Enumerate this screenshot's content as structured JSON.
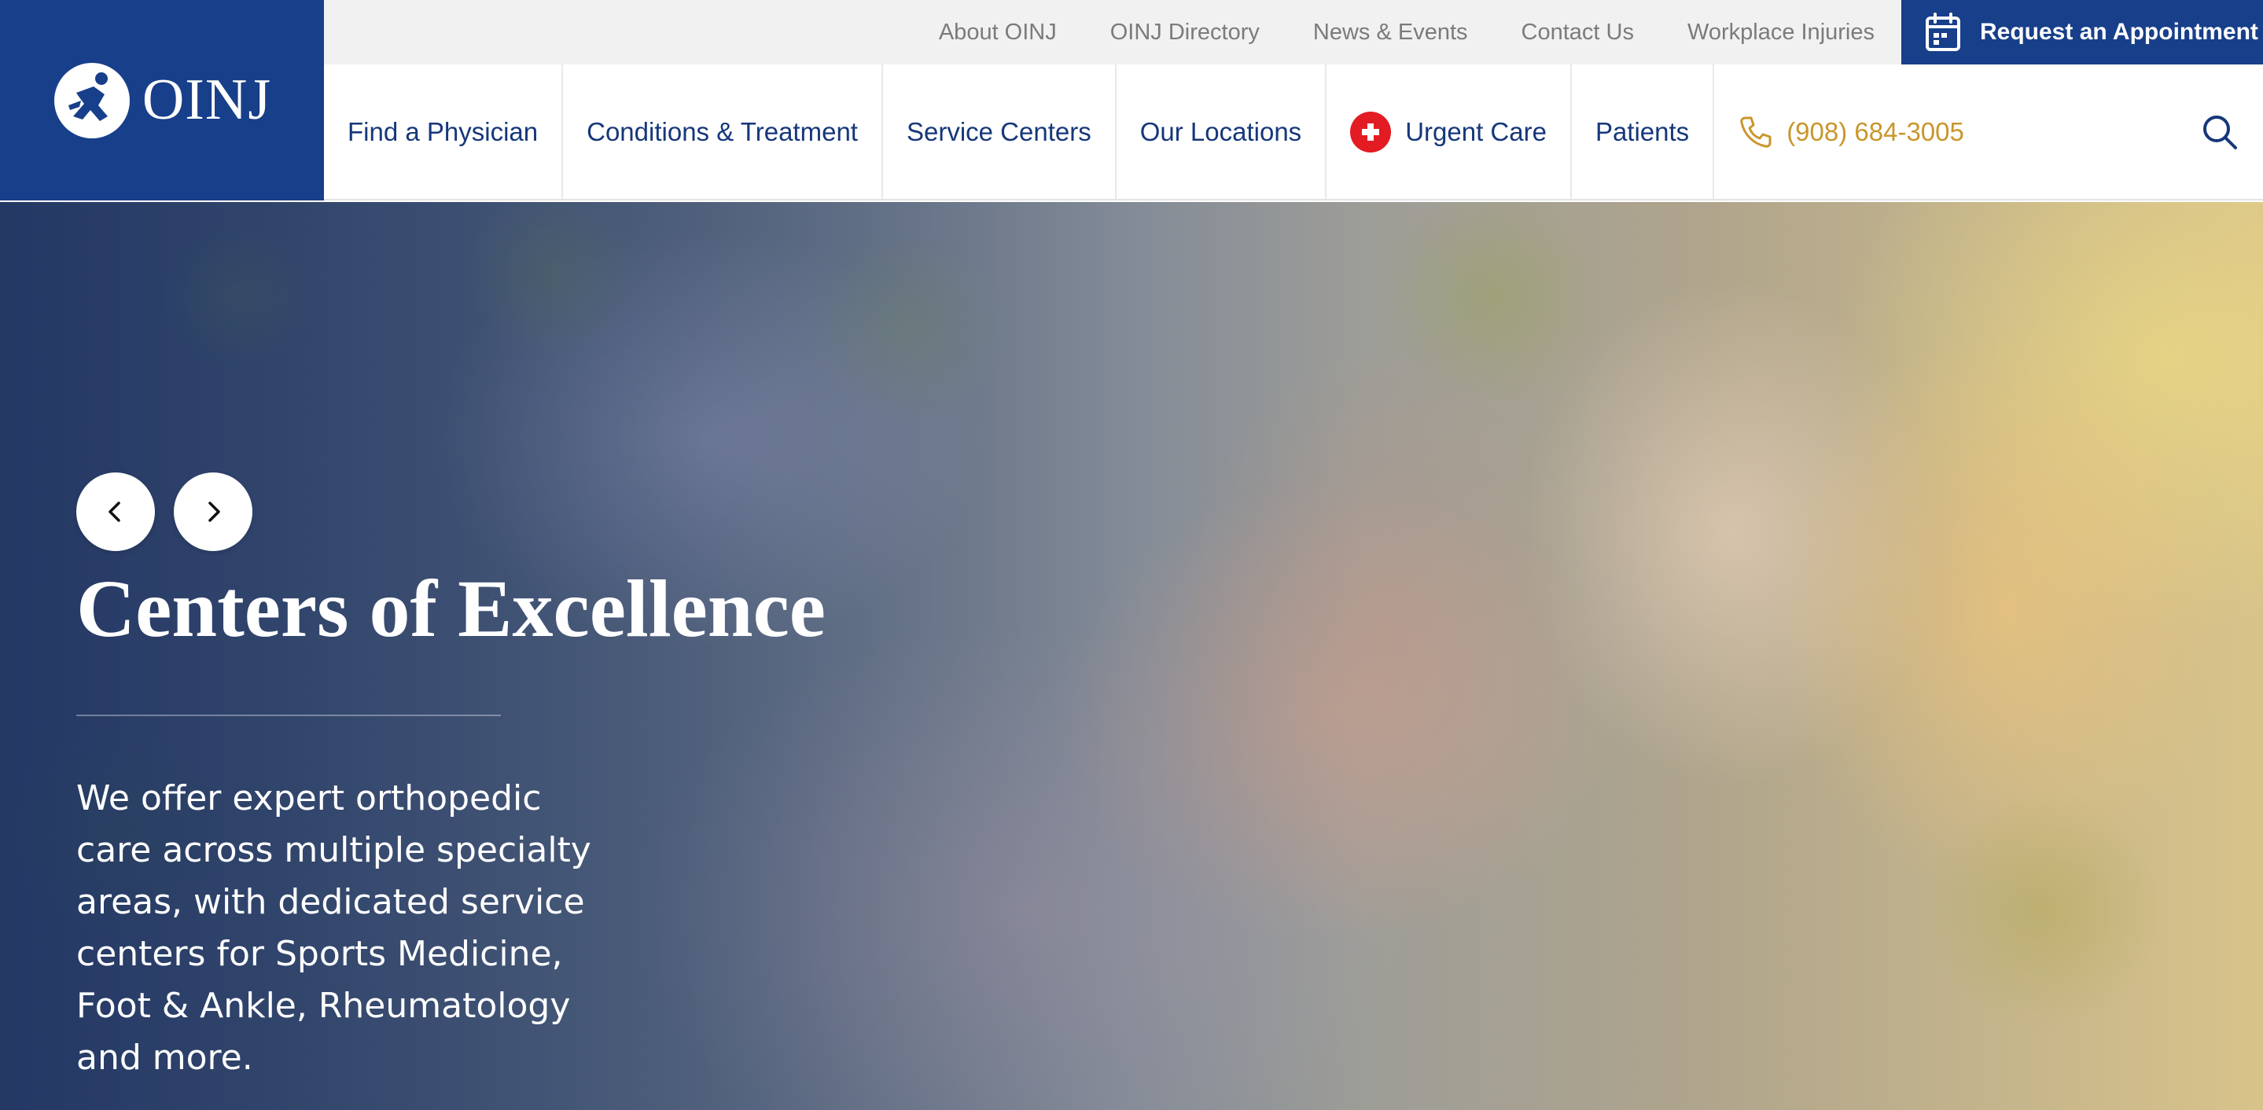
{
  "brand": {
    "logo_text": "OINJ",
    "color_primary": "#173f8a",
    "color_accent": "#c9962b",
    "color_urgent": "#e31b23"
  },
  "utility_nav": {
    "links": [
      "About OINJ",
      "OINJ Directory",
      "News & Events",
      "Contact Us",
      "Workplace Injuries"
    ],
    "appointment_label": "Request an Appointment",
    "appointment_icon": "calendar-icon"
  },
  "main_nav": {
    "items": [
      "Find a Physician",
      "Conditions & Treatment",
      "Service Centers",
      "Our Locations",
      "Urgent Care",
      "Patients"
    ],
    "urgent_icon": "red-cross-icon",
    "phone": "(908) 684-3005",
    "phone_icon": "phone-icon",
    "search_icon": "search-icon"
  },
  "hero": {
    "title": "Centers of Excellence",
    "text": "We offer expert orthopedic care across multiple specialty areas, with dedicated service centers for Sports Medicine, Foot & Ankle, Rheumatology and more.",
    "prev_icon": "chevron-left-icon",
    "next_icon": "chevron-right-icon"
  }
}
